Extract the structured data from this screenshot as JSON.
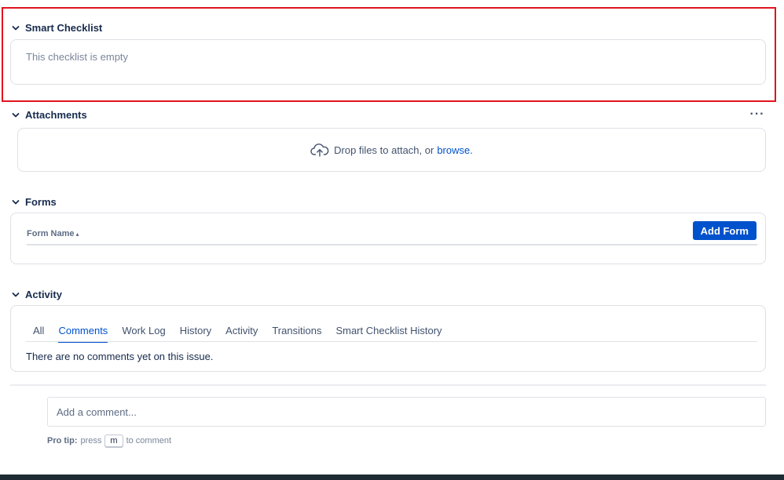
{
  "smart_checklist": {
    "title": "Smart Checklist",
    "empty_text": "This checklist is empty"
  },
  "attachments": {
    "title": "Attachments",
    "more_label": "···",
    "drop_text": "Drop files to attach, or",
    "browse_link": "browse."
  },
  "forms": {
    "title": "Forms",
    "column_header": "Form Name",
    "sort_indicator": "▴",
    "add_button": "Add Form"
  },
  "activity": {
    "title": "Activity",
    "tabs": [
      {
        "label": "All",
        "active": false
      },
      {
        "label": "Comments",
        "active": true
      },
      {
        "label": "Work Log",
        "active": false
      },
      {
        "label": "History",
        "active": false
      },
      {
        "label": "Activity",
        "active": false
      },
      {
        "label": "Transitions",
        "active": false
      },
      {
        "label": "Smart Checklist History",
        "active": false
      }
    ],
    "empty_text": "There are no comments yet on this issue."
  },
  "comment": {
    "placeholder": "Add a comment...",
    "pro_tip_label": "Pro tip:",
    "pro_tip_press": "press",
    "pro_tip_key": "m",
    "pro_tip_suffix": "to comment"
  },
  "colors": {
    "accent": "#0052cc",
    "highlight": "#e0141e",
    "footer": "#1e2b33"
  },
  "icons": {
    "section_toggle": "chevron-down-icon",
    "upload": "cloud-upload-icon",
    "more": "more-horizontal-icon"
  }
}
